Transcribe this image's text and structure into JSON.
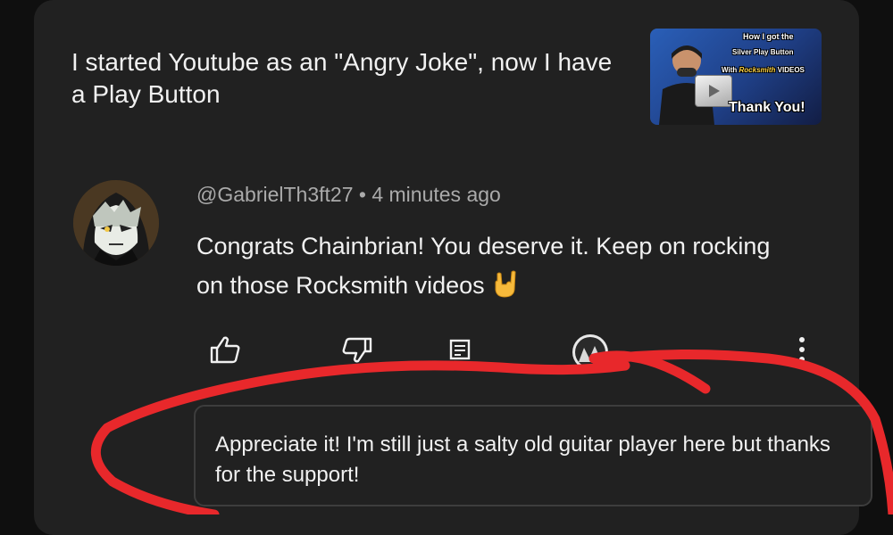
{
  "video": {
    "title": "I started Youtube as an \"Angry Joke\", now I have a Play Button",
    "thumbnail": {
      "line1": "How I got the",
      "line2": "Silver Play Button",
      "line3_prefix": "With",
      "line3_brand": "Rocksmith",
      "line3_suffix": "VIDEOS",
      "line4": "Thank You!"
    }
  },
  "comment": {
    "author": "@GabrielTh3ft27",
    "separator": "•",
    "time": "4 minutes ago",
    "text": "Congrats Chainbrian! You deserve it. Keep on rocking on those Rocksmith videos",
    "emoji": "rock-on-hand-emoji"
  },
  "actions": {
    "like_icon": "thumbs-up-icon",
    "dislike_icon": "thumbs-down-icon",
    "reply_icon": "reply-comment-icon",
    "creator_heart_icon": "creator-avatar",
    "more_icon": "more-vertical-icon"
  },
  "reply": {
    "text": "Appreciate it! I'm still just a salty old guitar player here but thanks for the support!"
  },
  "colors": {
    "page_bg": "#0f0f0f",
    "card_bg": "#212121",
    "text_primary": "#f1f1f1",
    "text_secondary": "#aaaaaa",
    "annotation_red": "#e8282b"
  }
}
